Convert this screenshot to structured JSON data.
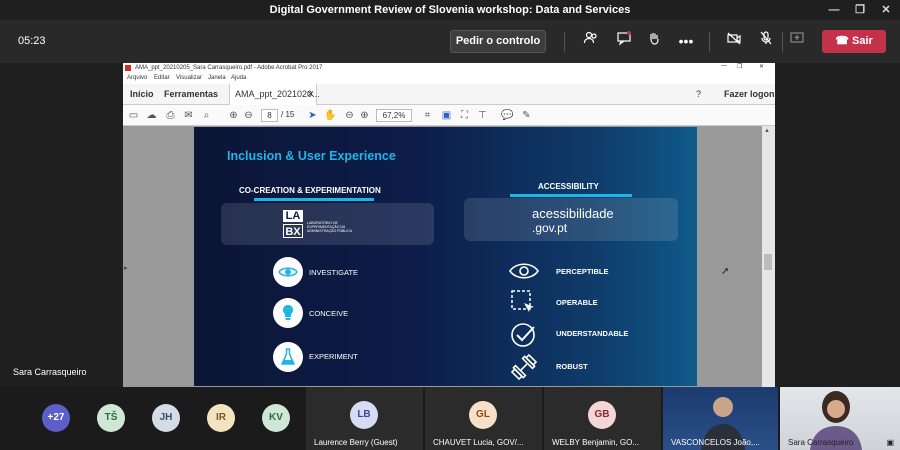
{
  "window": {
    "title": "Digital Government Review of Slovenia workshop: Data and Services"
  },
  "meeting": {
    "timer": "05:23",
    "control_label": "Pedir o controlo",
    "leave_label": "Sair",
    "presenter": "Sara Carrasqueiro"
  },
  "acrobat": {
    "title": "AMA_ppt_20210205_Sara Carrasqueiro.pdf - Adobe Acrobat Pro 2017",
    "menu": [
      "Arquivo",
      "Editar",
      "Visualizar",
      "Janela",
      "Ajuda"
    ],
    "tabs": {
      "home": "Início",
      "tools": "Ferramentas",
      "doc": "AMA_ppt_2021020...",
      "login": "Fazer logon"
    },
    "page_current": "8",
    "page_total": "/ 15",
    "zoom": "67,2%"
  },
  "slide": {
    "title": "Inclusion & User Experience",
    "left_heading": "CO-CREATION & EXPERIMENTATION",
    "right_heading": "ACCESSIBILITY",
    "labx_top": "LA",
    "labx_bottom": "BX",
    "labx_caption": "LABORATÓRIO DE EXPERIMENTAÇÃO DA ADMINISTRAÇÃO PÚBLICA",
    "acc_logo_1": "acessibilidade",
    "acc_logo_2": ".gov.pt",
    "left_items": [
      "INVESTIGATE",
      "CONCEIVE",
      "EXPERIMENT"
    ],
    "right_items": [
      "PERCEPTIBLE",
      "OPERABLE",
      "UNDERSTANDABLE",
      "ROBUST"
    ]
  },
  "gallery": {
    "overflow": "+27",
    "avatars": [
      {
        "initials": "TŠ",
        "bg": "#cfe7d6",
        "fg": "#2e6b3f"
      },
      {
        "initials": "JH",
        "bg": "#d4dce8",
        "fg": "#3b4d6b"
      },
      {
        "initials": "IR",
        "bg": "#f3e3c0",
        "fg": "#7a5a1a"
      },
      {
        "initials": "KV",
        "bg": "#cfe7d6",
        "fg": "#2e6b3f"
      }
    ],
    "tiles": [
      {
        "initials": "LB",
        "name": "Laurence Berry (Guest)",
        "bg": "#d8dcf3",
        "fg": "#3a46a0"
      },
      {
        "initials": "GL",
        "name": "CHAUVET Lucia, GOV/...",
        "bg": "#f6e0c8",
        "fg": "#8a4d12"
      },
      {
        "initials": "GB",
        "name": "WELBY Benjamin, GO...",
        "bg": "#f3d6d6",
        "fg": "#8a2a2a"
      }
    ],
    "video1": "VASCONCELOS João,...",
    "video2": "Sara Carrasqueiro"
  },
  "colors": {
    "leave": "#c4314b",
    "overflow": "#5b5fc7",
    "slide_accent": "#1fb6e6"
  }
}
